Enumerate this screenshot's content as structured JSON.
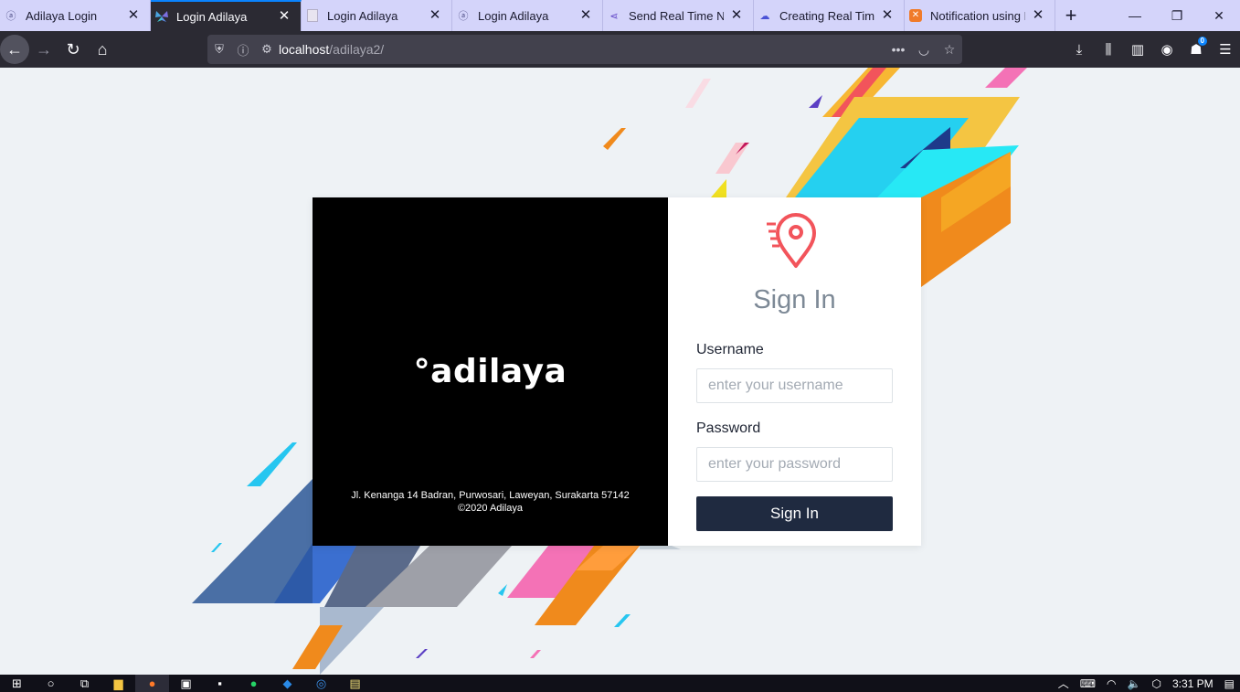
{
  "tabs": [
    {
      "title": "Adilaya Login",
      "icon": "adilaya-icon",
      "active": false
    },
    {
      "title": "Login Adilaya",
      "icon": "butterfly-icon",
      "active": true
    },
    {
      "title": "Login Adilaya",
      "icon": "page-icon",
      "active": false
    },
    {
      "title": "Login Adilaya",
      "icon": "adilaya-icon",
      "active": false
    },
    {
      "title": "Send Real Time Not",
      "icon": "share-icon",
      "active": false
    },
    {
      "title": "Creating Real Time",
      "icon": "cloud-icon",
      "active": false
    },
    {
      "title": "Notification using P",
      "icon": "xampp-icon",
      "active": false
    }
  ],
  "url": {
    "host": "localhost",
    "path": "/adilaya2/"
  },
  "toolbar": {
    "notification_count": "0"
  },
  "login": {
    "brand": "°adilaya",
    "address_line1": "Jl. Kenanga 14 Badran, Purwosari, Laweyan, Surakarta 57142",
    "address_line2": "©2020  Adilaya",
    "title": "Sign In",
    "username_label": "Username",
    "username_placeholder": "enter your username",
    "password_label": "Password",
    "password_placeholder": "enter your password",
    "submit_label": "Sign In"
  },
  "taskbar": {
    "time": "3:31 PM"
  },
  "colors": {
    "accent": "#f2545b",
    "button": "#1f2a40",
    "tab_active": "#2b2a33",
    "tabbar": "#d4d4fa"
  }
}
